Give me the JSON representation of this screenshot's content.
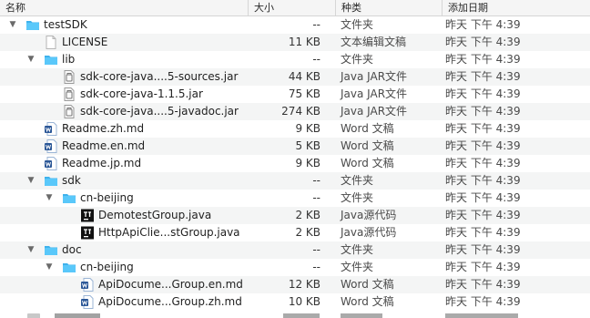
{
  "columns": {
    "name": "名称",
    "size": "大小",
    "kind": "种类",
    "date": "添加日期"
  },
  "colors": {
    "folder": "#5ac8fa",
    "folder_tab": "#3fb2ec",
    "alt_row": "#f4f5f5"
  },
  "rows": [
    {
      "level": 0,
      "disclosure": "open",
      "icon": "folder-icon",
      "name": "testSDK",
      "size": "--",
      "kind": "文件夹",
      "date": "昨天 下午 4:39"
    },
    {
      "level": 1,
      "disclosure": "none",
      "icon": "text-file-icon",
      "name": "LICENSE",
      "size": "11 KB",
      "kind": "文本编辑文稿",
      "date": "昨天 下午 4:39"
    },
    {
      "level": 1,
      "disclosure": "open",
      "icon": "folder-icon",
      "name": "lib",
      "size": "--",
      "kind": "文件夹",
      "date": "昨天 下午 4:39"
    },
    {
      "level": 2,
      "disclosure": "none",
      "icon": "jar-file-icon",
      "name": "sdk-core-java....5-sources.jar",
      "size": "44 KB",
      "kind": "Java JAR文件",
      "date": "昨天 下午 4:39"
    },
    {
      "level": 2,
      "disclosure": "none",
      "icon": "jar-file-icon",
      "name": "sdk-core-java-1.1.5.jar",
      "size": "75 KB",
      "kind": "Java JAR文件",
      "date": "昨天 下午 4:39"
    },
    {
      "level": 2,
      "disclosure": "none",
      "icon": "jar-file-icon",
      "name": "sdk-core-java....5-javadoc.jar",
      "size": "274 KB",
      "kind": "Java JAR文件",
      "date": "昨天 下午 4:39"
    },
    {
      "level": 1,
      "disclosure": "none",
      "icon": "word-doc-icon",
      "name": "Readme.zh.md",
      "size": "9 KB",
      "kind": "Word 文稿",
      "date": "昨天 下午 4:39"
    },
    {
      "level": 1,
      "disclosure": "none",
      "icon": "word-doc-icon",
      "name": "Readme.en.md",
      "size": "5 KB",
      "kind": "Word 文稿",
      "date": "昨天 下午 4:39"
    },
    {
      "level": 1,
      "disclosure": "none",
      "icon": "word-doc-icon",
      "name": "Readme.jp.md",
      "size": "9 KB",
      "kind": "Word 文稿",
      "date": "昨天 下午 4:39"
    },
    {
      "level": 1,
      "disclosure": "open",
      "icon": "folder-icon",
      "name": "sdk",
      "size": "--",
      "kind": "文件夹",
      "date": "昨天 下午 4:39"
    },
    {
      "level": 2,
      "disclosure": "open",
      "icon": "folder-icon",
      "name": "cn-beijing",
      "size": "--",
      "kind": "文件夹",
      "date": "昨天 下午 4:39"
    },
    {
      "level": 3,
      "disclosure": "none",
      "icon": "java-source-icon",
      "name": "DemotestGroup.java",
      "size": "2 KB",
      "kind": "Java源代码",
      "date": "昨天 下午 4:39"
    },
    {
      "level": 3,
      "disclosure": "none",
      "icon": "java-source-icon",
      "name": "HttpApiClie...stGroup.java",
      "size": "2 KB",
      "kind": "Java源代码",
      "date": "昨天 下午 4:39"
    },
    {
      "level": 1,
      "disclosure": "open",
      "icon": "folder-icon",
      "name": "doc",
      "size": "--",
      "kind": "文件夹",
      "date": "昨天 下午 4:39"
    },
    {
      "level": 2,
      "disclosure": "open",
      "icon": "folder-icon",
      "name": "cn-beijing",
      "size": "--",
      "kind": "文件夹",
      "date": "昨天 下午 4:39"
    },
    {
      "level": 3,
      "disclosure": "none",
      "icon": "word-doc-icon",
      "name": "ApiDocume...Group.en.md",
      "size": "12 KB",
      "kind": "Word 文稿",
      "date": "昨天 下午 4:39"
    },
    {
      "level": 3,
      "disclosure": "none",
      "icon": "word-doc-icon",
      "name": "ApiDocume...Group.zh.md",
      "size": "10 KB",
      "kind": "Word 文稿",
      "date": "昨天 下午 4:39"
    }
  ]
}
